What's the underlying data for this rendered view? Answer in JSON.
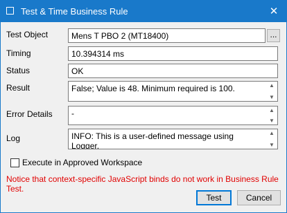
{
  "window": {
    "title": "Test & Time Business Rule",
    "close_glyph": "✕"
  },
  "form": {
    "test_object": {
      "label": "Test Object",
      "value": "Mens T PBO 2 (MT18400)",
      "browse_label": "..."
    },
    "timing": {
      "label": "Timing",
      "value": "10.394314 ms"
    },
    "status": {
      "label": "Status",
      "value": "OK"
    },
    "result": {
      "label": "Result",
      "value": "False; Value is 48. Minimum required is 100."
    },
    "error_details": {
      "label": "Error Details",
      "value": "-"
    },
    "log": {
      "label": "Log",
      "value": "INFO: This is a user-defined message using Logger."
    }
  },
  "options": {
    "execute_label": "Execute in Approved Workspace",
    "execute_checked": false
  },
  "notice": "Notice that context-specific JavaScript binds do not work in Business Rule Test.",
  "buttons": {
    "test_label": "Test",
    "cancel_label": "Cancel"
  },
  "scroll": {
    "up_glyph": "▲",
    "down_glyph": "▼"
  },
  "colors": {
    "titlebar": "#1979ca",
    "notice": "#e10000",
    "default_button_border": "#0078d7"
  },
  "icons": {
    "app": "window-icon",
    "close": "close-icon",
    "scroll_up": "scroll-up-arrow-icon",
    "scroll_down": "scroll-down-arrow-icon"
  }
}
